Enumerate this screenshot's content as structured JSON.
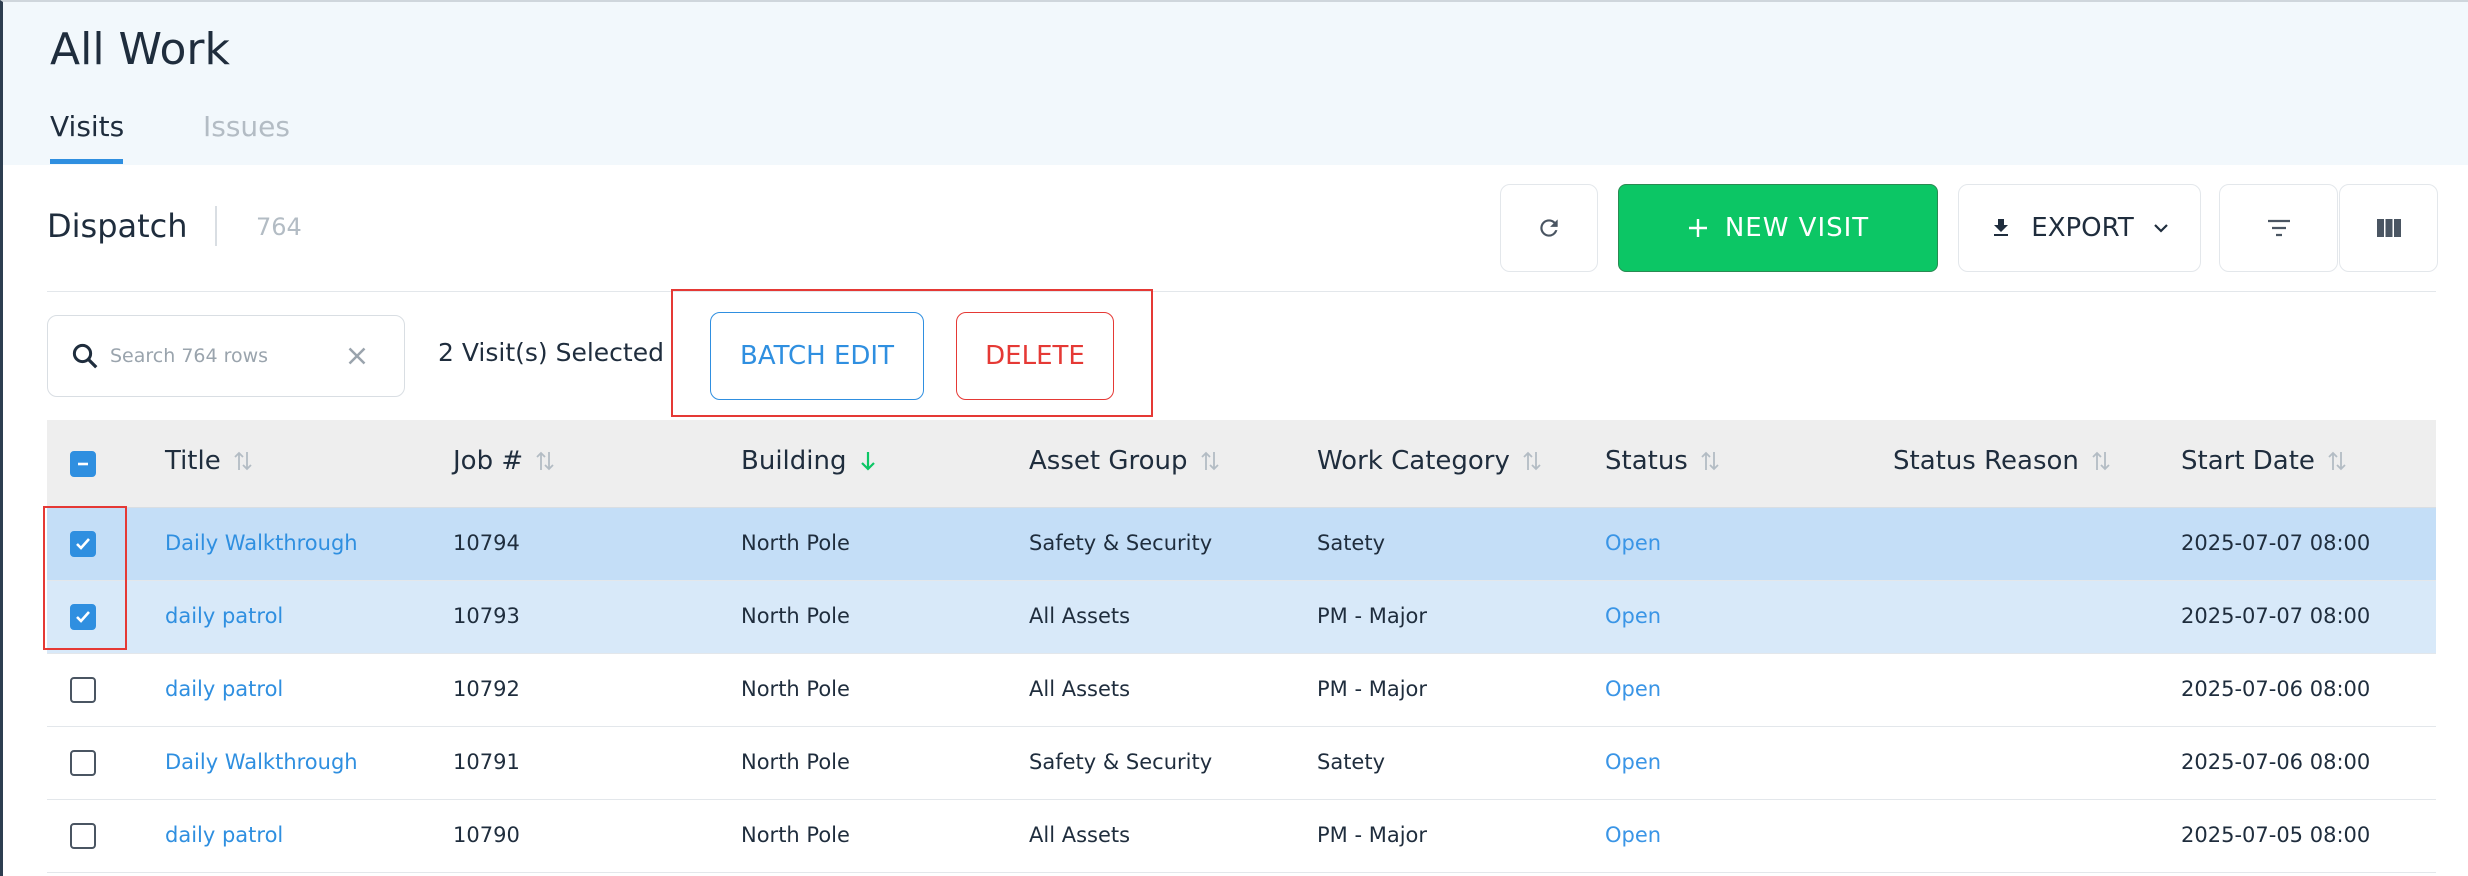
{
  "page": {
    "title": "All Work"
  },
  "tabs": [
    {
      "label": "Visits",
      "active": true
    },
    {
      "label": "Issues",
      "active": false
    }
  ],
  "section": {
    "title": "Dispatch",
    "count": "764"
  },
  "toolbar": {
    "new_visit_label": "NEW VISIT",
    "export_label": "EXPORT",
    "accent_color": "#0cc665"
  },
  "search": {
    "placeholder": "Search 764 rows",
    "value": ""
  },
  "selection": {
    "text": "2 Visit(s) Selected",
    "batch_edit_label": "BATCH EDIT",
    "delete_label": "DELETE"
  },
  "table": {
    "columns": [
      "Title",
      "Job #",
      "Building",
      "Asset Group",
      "Work Category",
      "Status",
      "Status Reason",
      "Start Date"
    ],
    "sorted_column": "Building",
    "rows": [
      {
        "checked": true,
        "title": "Daily Walkthrough",
        "job": "10794",
        "building": "North Pole",
        "asset_group": "Safety & Security",
        "work_category": "Satety",
        "status": "Open",
        "status_reason": "",
        "start_date": "2025-07-07 08:00"
      },
      {
        "checked": true,
        "title": "daily patrol",
        "job": "10793",
        "building": "North Pole",
        "asset_group": "All Assets",
        "work_category": "PM - Major",
        "status": "Open",
        "status_reason": "",
        "start_date": "2025-07-07 08:00"
      },
      {
        "checked": false,
        "title": "daily patrol",
        "job": "10792",
        "building": "North Pole",
        "asset_group": "All Assets",
        "work_category": "PM - Major",
        "status": "Open",
        "status_reason": "",
        "start_date": "2025-07-06 08:00"
      },
      {
        "checked": false,
        "title": "Daily Walkthrough",
        "job": "10791",
        "building": "North Pole",
        "asset_group": "Safety & Security",
        "work_category": "Satety",
        "status": "Open",
        "status_reason": "",
        "start_date": "2025-07-06 08:00"
      },
      {
        "checked": false,
        "title": "daily patrol",
        "job": "10790",
        "building": "North Pole",
        "asset_group": "All Assets",
        "work_category": "PM - Major",
        "status": "Open",
        "status_reason": "",
        "start_date": "2025-07-05 08:00"
      }
    ]
  }
}
